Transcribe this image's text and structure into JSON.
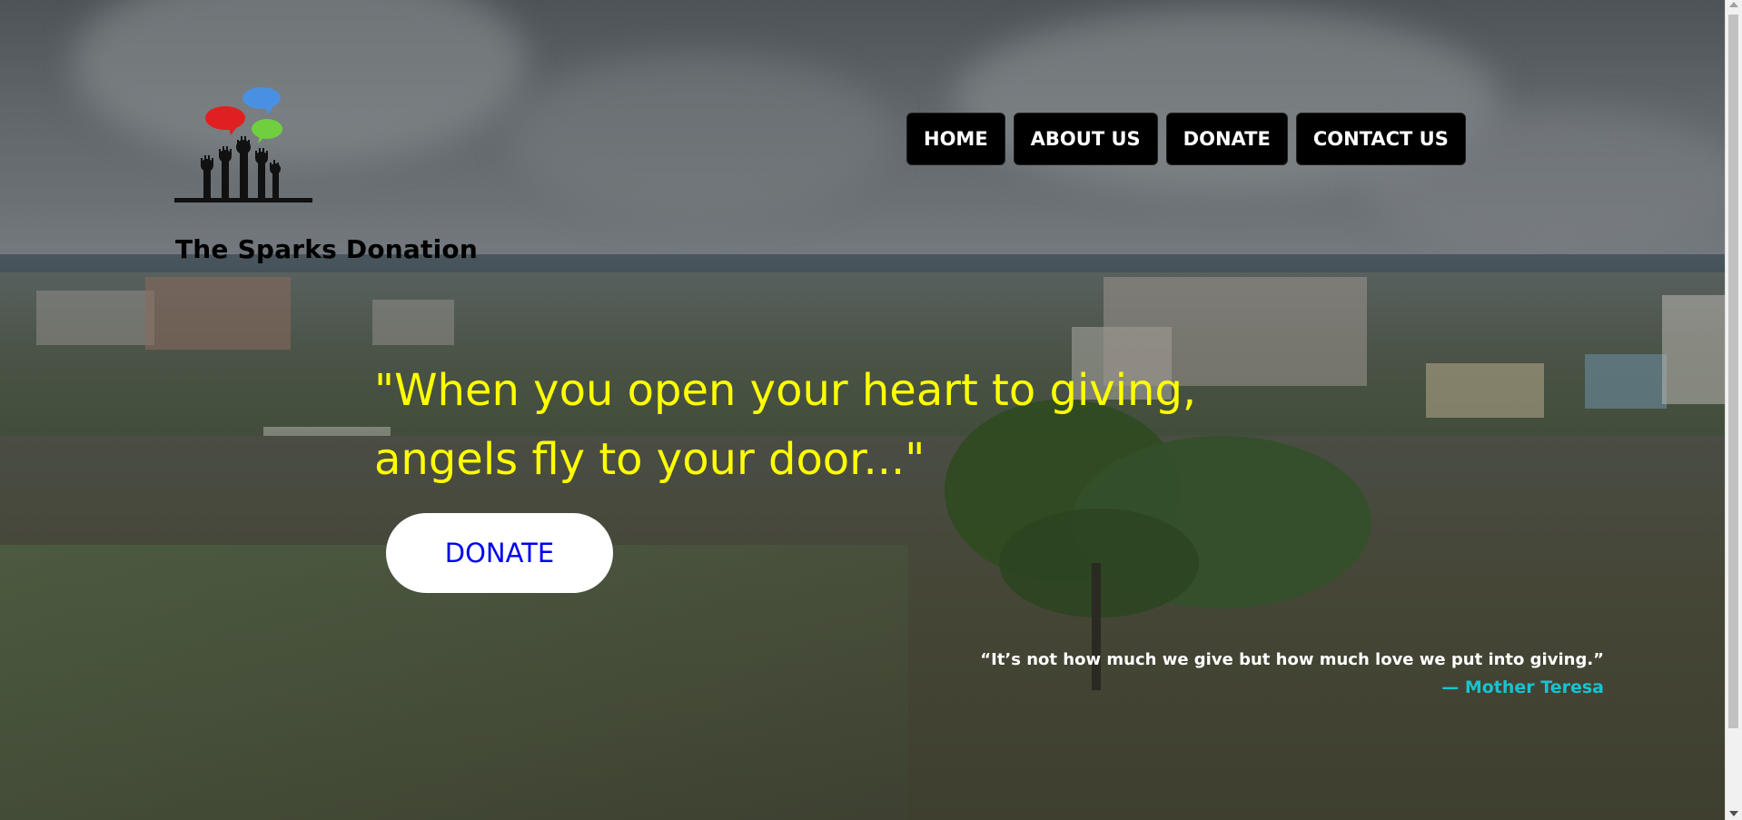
{
  "brand": {
    "name": "The Sparks Donation"
  },
  "nav": {
    "items": [
      {
        "label": "HOME"
      },
      {
        "label": "ABOUT US"
      },
      {
        "label": "DONATE"
      },
      {
        "label": "CONTACT US"
      }
    ]
  },
  "hero": {
    "headline_line1": "\"When you open your heart to giving,",
    "headline_line2": "angels fly to your door...\"",
    "cta_label": "DONATE"
  },
  "quote": {
    "text": "“It’s not how much we give but how much love we put into giving.”",
    "author": "— Mother Teresa"
  },
  "colors": {
    "headline": "#ffff00",
    "nav_bg": "#000000",
    "cta_text": "#0000ee",
    "quote_author": "#17c3cf"
  }
}
